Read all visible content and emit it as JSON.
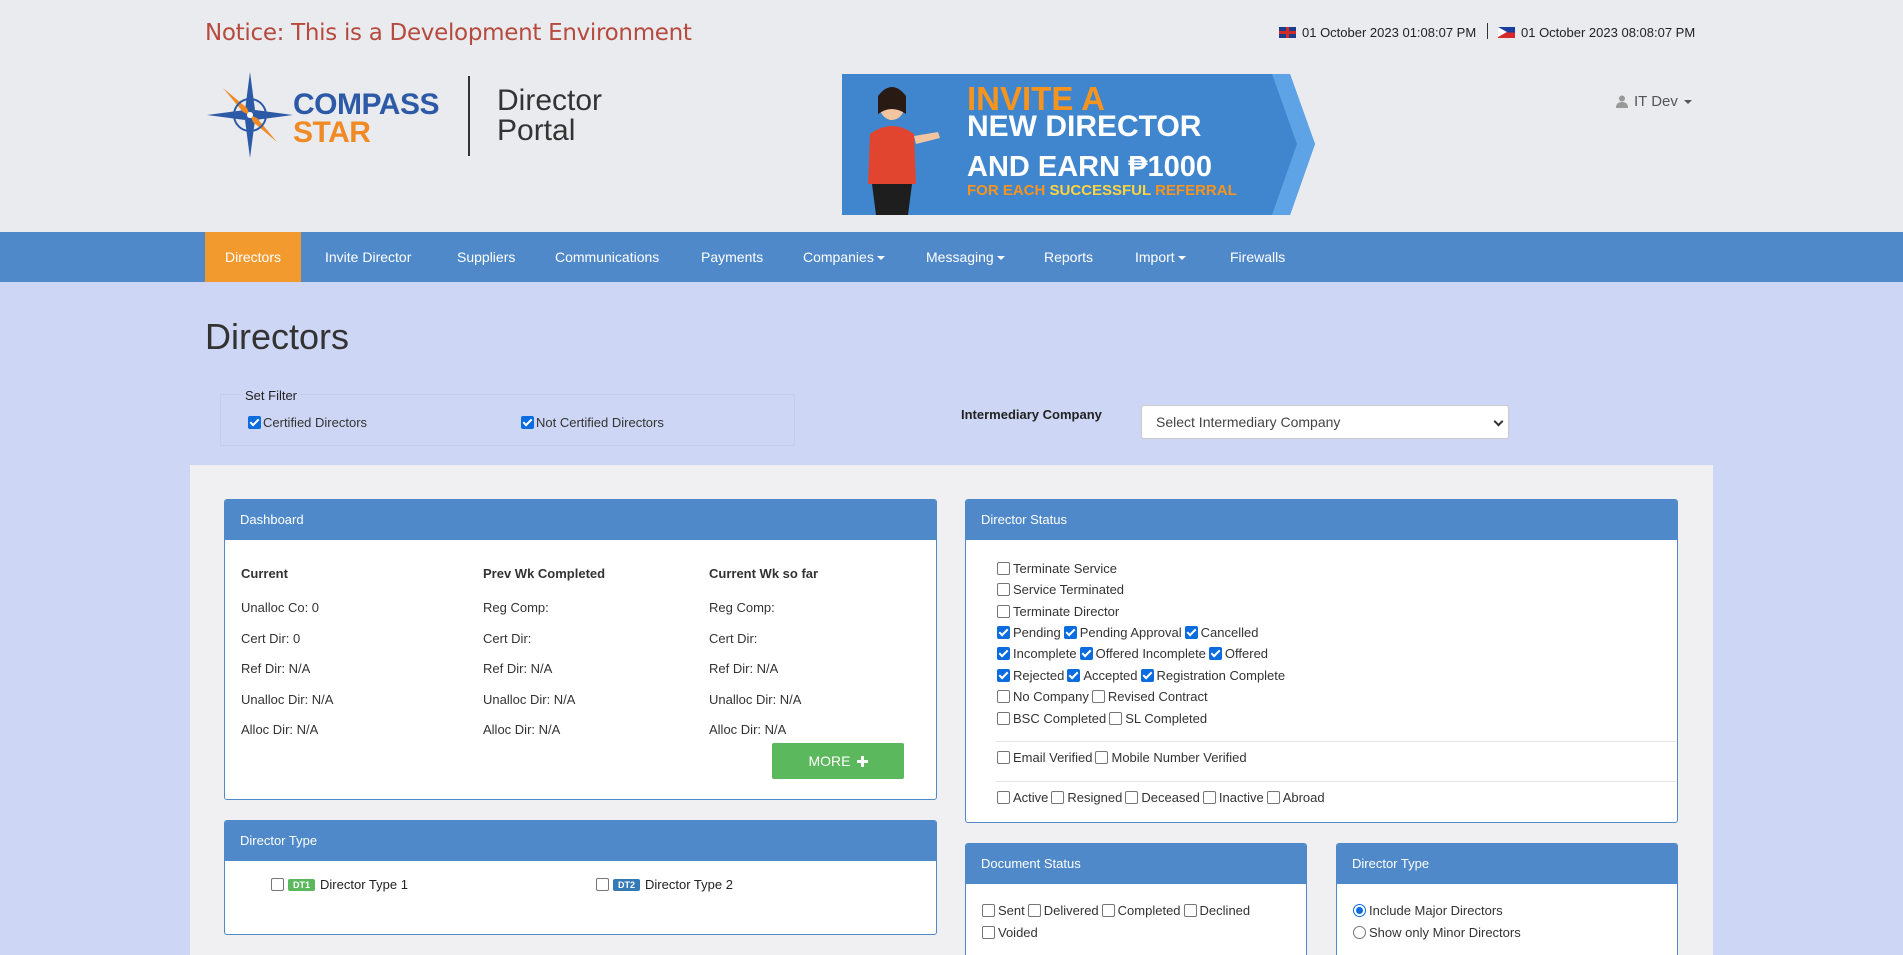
{
  "header": {
    "notice": "Notice: This is a Development Environment",
    "clock_uk": "01 October 2023 01:08:07 PM",
    "clock_ph": "01 October 2023 08:08:07 PM",
    "logo_line1": "COMPASS",
    "logo_line2": "STAR",
    "portal_line1": "Director",
    "portal_line2": "Portal",
    "user_name": "IT Dev"
  },
  "banner": {
    "line1": "INVITE A",
    "line2": "NEW DIRECTOR",
    "line3": "AND EARN ₱1000",
    "line4_prefix": "FOR EACH ",
    "line4_highlight": "SUCCESSFUL",
    "line4_suffix": " REFERRAL"
  },
  "nav": [
    {
      "label": "Directors",
      "active": true
    },
    {
      "label": "Invite Director"
    },
    {
      "label": "Suppliers"
    },
    {
      "label": "Communications"
    },
    {
      "label": "Payments"
    },
    {
      "label": "Companies",
      "dropdown": true
    },
    {
      "label": "Messaging",
      "dropdown": true
    },
    {
      "label": "Reports"
    },
    {
      "label": "Import",
      "dropdown": true
    },
    {
      "label": "Firewalls"
    }
  ],
  "page_title": "Directors",
  "filter": {
    "legend": "Set Filter",
    "certified": {
      "label": "Certified Directors",
      "checked": true
    },
    "not_certified": {
      "label": "Not Certified Directors",
      "checked": true
    }
  },
  "intermediary": {
    "label": "Intermediary Company",
    "selected": "Select Intermediary Company"
  },
  "dashboard": {
    "title": "Dashboard",
    "columns": [
      {
        "heading": "Current",
        "rows": [
          "Unalloc Co: 0",
          "Cert Dir: 0",
          "Ref Dir: N/A",
          "Unalloc Dir: N/A",
          "Alloc Dir: N/A"
        ]
      },
      {
        "heading": "Prev Wk Completed",
        "rows": [
          "Reg Comp:",
          "Cert Dir:",
          "Ref Dir: N/A",
          "Unalloc Dir: N/A",
          "Alloc Dir: N/A"
        ]
      },
      {
        "heading": "Current Wk so far",
        "rows": [
          "Reg Comp:",
          "Cert Dir:",
          "Ref Dir: N/A",
          "Unalloc Dir: N/A",
          "Alloc Dir: N/A"
        ]
      }
    ],
    "more_label": "MORE"
  },
  "director_type_left": {
    "title": "Director Type",
    "items": [
      {
        "badge": "DT1",
        "label": "Director Type 1",
        "checked": false
      },
      {
        "badge": "DT2",
        "label": "Director Type 2",
        "checked": false
      }
    ]
  },
  "director_status": {
    "title": "Director Status",
    "lines": [
      [
        {
          "label": "Terminate Service",
          "checked": false
        }
      ],
      [
        {
          "label": "Service Terminated",
          "checked": false
        }
      ],
      [
        {
          "label": "Terminate Director",
          "checked": false
        }
      ],
      [
        {
          "label": "Pending",
          "checked": true
        },
        {
          "label": "Pending Approval",
          "checked": true
        },
        {
          "label": "Cancelled",
          "checked": true
        }
      ],
      [
        {
          "label": "Incomplete",
          "checked": true
        },
        {
          "label": "Offered Incomplete",
          "checked": true
        },
        {
          "label": "Offered",
          "checked": true
        }
      ],
      [
        {
          "label": "Rejected",
          "checked": true
        },
        {
          "label": "Accepted",
          "checked": true
        },
        {
          "label": "Registration Complete",
          "checked": true
        }
      ],
      [
        {
          "label": "No Company",
          "checked": false
        },
        {
          "label": "Revised Contract",
          "checked": false
        }
      ],
      [
        {
          "label": "BSC Completed",
          "checked": false
        },
        {
          "label": "SL Completed",
          "checked": false
        }
      ],
      [
        {
          "label": "Email Verified",
          "checked": false
        },
        {
          "label": "Mobile Number Verified",
          "checked": false
        }
      ],
      [
        {
          "label": "Active",
          "checked": false
        },
        {
          "label": "Resigned",
          "checked": false
        },
        {
          "label": "Deceased",
          "checked": false
        },
        {
          "label": "Inactive",
          "checked": false
        },
        {
          "label": "Abroad",
          "checked": false
        }
      ]
    ]
  },
  "document_status": {
    "title": "Document Status",
    "lines": [
      [
        {
          "label": "Sent",
          "checked": false
        },
        {
          "label": "Delivered",
          "checked": false
        },
        {
          "label": "Completed",
          "checked": false
        },
        {
          "label": "Declined",
          "checked": false
        }
      ],
      [
        {
          "label": "Voided",
          "checked": false
        }
      ]
    ]
  },
  "director_type_right": {
    "title": "Director Type",
    "options": [
      {
        "label": "Include Major Directors",
        "checked": true
      },
      {
        "label": "Show only Minor Directors",
        "checked": false
      }
    ]
  },
  "colors": {
    "nav_bg": "#4f89c9",
    "nav_active": "#f39a2f",
    "notice": "#b64a3e",
    "more_button": "#5cb85c"
  }
}
